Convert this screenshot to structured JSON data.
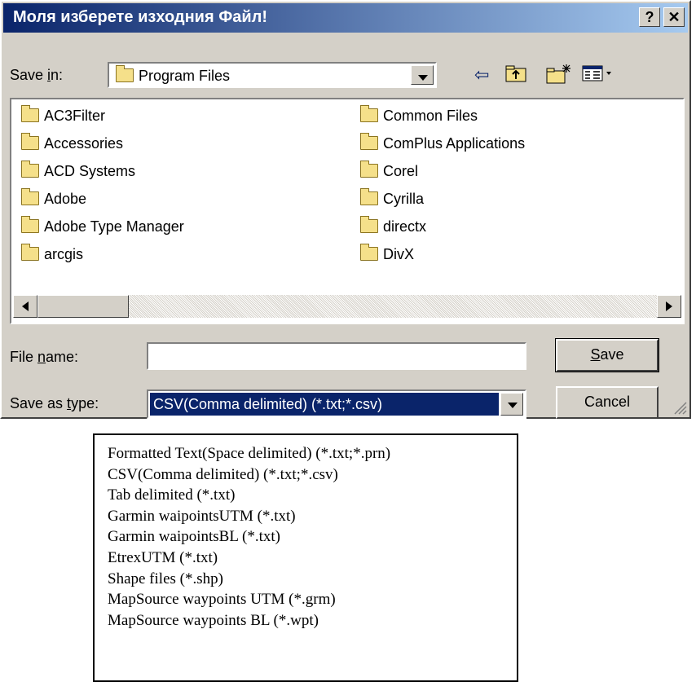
{
  "window": {
    "title": "Моля изберете изходния Файл!",
    "help_button": "?",
    "close_button": "✕"
  },
  "save_in": {
    "label_pre": "Save ",
    "label_accel": "i",
    "label_post": "n:",
    "value": "Program Files",
    "folder_icon": "folder-icon"
  },
  "toolbar": {
    "back_icon": "back-arrow-icon",
    "up_icon": "up-folder-icon",
    "new_folder_icon": "new-folder-icon",
    "view_icon": "view-menu-icon"
  },
  "files": {
    "left": [
      "AC3Filter",
      "Accessories",
      "ACD Systems",
      "Adobe",
      "Adobe Type Manager",
      "arcgis"
    ],
    "right": [
      "Common Files",
      "ComPlus Applications",
      "Corel",
      "Cyrilla",
      "directx",
      "DivX"
    ]
  },
  "file_name": {
    "label_pre": "File ",
    "label_accel": "n",
    "label_post": "ame:",
    "value": ""
  },
  "save_as_type": {
    "label_pre": "Save as ",
    "label_accel": "t",
    "label_post": "ype:",
    "value": "CSV(Comma delimited) (*.txt;*.csv)"
  },
  "buttons": {
    "save_accel": "S",
    "save_rest": "ave",
    "cancel": "Cancel"
  },
  "type_options": [
    "Formatted Text(Space delimited) (*.txt;*.prn)",
    "CSV(Comma delimited) (*.txt;*.csv)",
    "Tab delimited (*.txt)",
    "Garmin waipointsUTM (*.txt)",
    "Garmin waipointsBL (*.txt)",
    "EtrexUTM (*.txt)",
    "Shape files (*.shp)",
    "MapSource waypoints UTM (*.grm)",
    "MapSource waypoints BL (*.wpt)"
  ]
}
